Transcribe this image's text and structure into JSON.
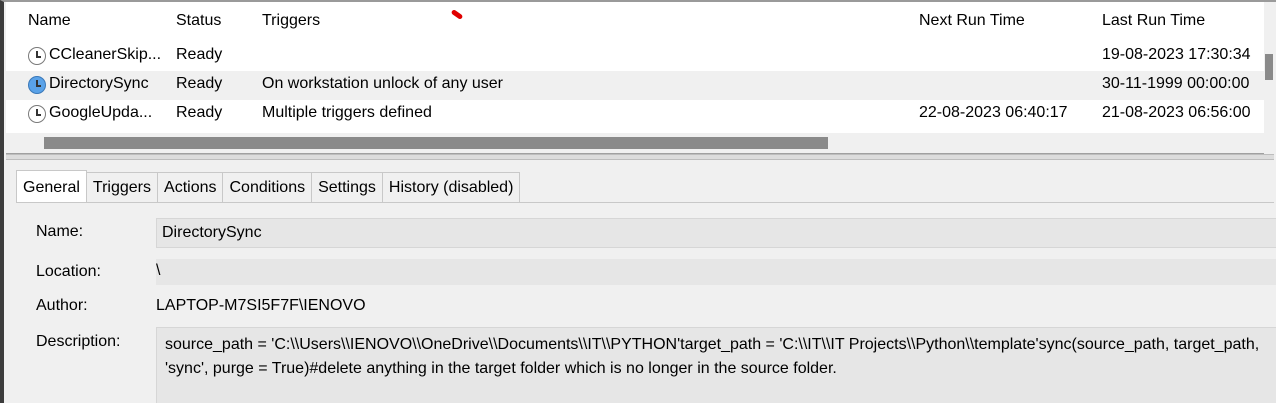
{
  "task_list": {
    "columns": {
      "name": "Name",
      "status": "Status",
      "triggers": "Triggers",
      "next_run": "Next Run Time",
      "last_run": "Last Run Time"
    },
    "rows": [
      {
        "name": "CCleanerSkip...",
        "status": "Ready",
        "triggers": "",
        "next_run": "",
        "last_run": "19-08-2023 17:30:34",
        "icon": "clock-icon"
      },
      {
        "name": "DirectorySync",
        "status": "Ready",
        "triggers": "On workstation unlock of any user",
        "next_run": "",
        "last_run": "30-11-1999 00:00:00",
        "icon": "clock-icon"
      },
      {
        "name": "GoogleUpda...",
        "status": "Ready",
        "triggers": "Multiple triggers defined",
        "next_run": "22-08-2023 06:40:17",
        "last_run": "21-08-2023 06:56:00",
        "icon": "clock-icon"
      }
    ]
  },
  "tabs": [
    "General",
    "Triggers",
    "Actions",
    "Conditions",
    "Settings",
    "History (disabled)"
  ],
  "general": {
    "name_label": "Name:",
    "name_value": "DirectorySync",
    "location_label": "Location:",
    "location_value": "\\",
    "author_label": "Author:",
    "author_value": "LAPTOP-M7SI5F7F\\IENOVO",
    "description_label": "Description:",
    "description_value": "source_path = 'C:\\\\Users\\\\IENOVO\\\\OneDrive\\\\Documents\\\\IT\\\\PYTHON'target_path = 'C:\\\\IT\\\\IT Projects\\\\Python\\\\template'sync(source_path, target_path, 'sync', purge = True)#delete anything in the target folder which is no longer in the source folder."
  },
  "colors": {
    "selected_row": "#f0f0f0",
    "scroll_thumb": "#8a8a8a",
    "annotation_mark": "#e00000"
  }
}
